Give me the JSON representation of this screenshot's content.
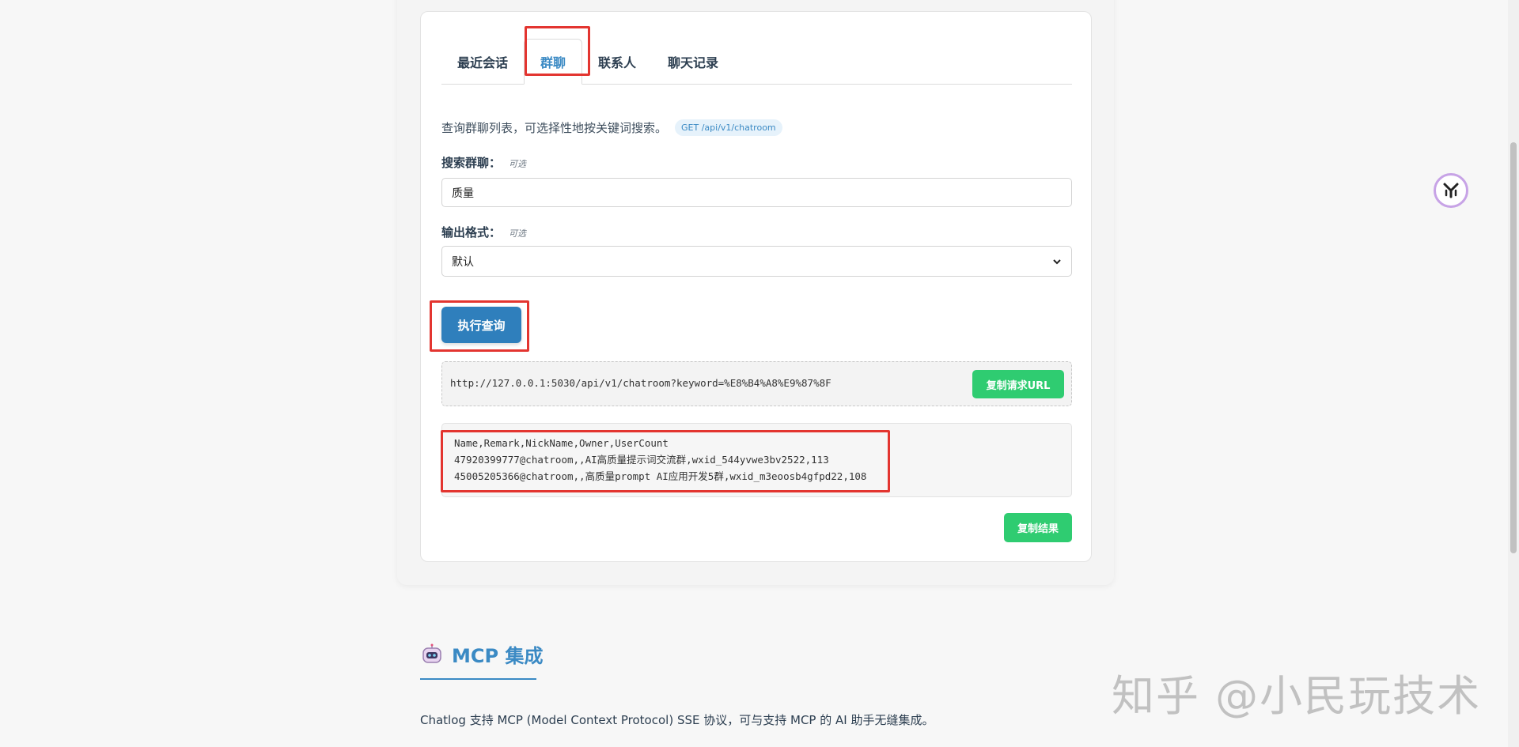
{
  "tabs": [
    {
      "label": "最近会话"
    },
    {
      "label": "群聊"
    },
    {
      "label": "联系人"
    },
    {
      "label": "聊天记录"
    }
  ],
  "description": {
    "text": "查询群聊列表，可选择性地按关键词搜索。",
    "endpoint": "GET /api/v1/chatroom"
  },
  "search": {
    "label": "搜索群聊：",
    "optional": "可选",
    "value": "质量"
  },
  "format": {
    "label": "输出格式：",
    "optional": "可选",
    "selected": "默认"
  },
  "query_button": "执行查询",
  "request_url": "http://127.0.0.1:5030/api/v1/chatroom?keyword=%E8%B4%A8%E9%87%8F",
  "copy_url_button": "复制请求URL",
  "result": {
    "lines": [
      "Name,Remark,NickName,Owner,UserCount",
      "47920399777@chatroom,,AI高质量提示词交流群,wxid_544yvwe3bv2522,113",
      "45005205366@chatroom,,高质量prompt AI应用开发5群,wxid_m3eoosb4gfpd22,108"
    ]
  },
  "copy_result_button": "复制结果",
  "mcp": {
    "title": "MCP 集成",
    "description": "Chatlog 支持 MCP (Model Context Protocol) SSE 协议，可与支持 MCP 的 AI 助手无缝集成。"
  },
  "watermark": "知乎 @小民玩技术",
  "colors": {
    "accent": "#3b8ac4",
    "primary_button": "#2f7fbc",
    "success_button": "#2fcc71",
    "highlight": "#e33530"
  }
}
